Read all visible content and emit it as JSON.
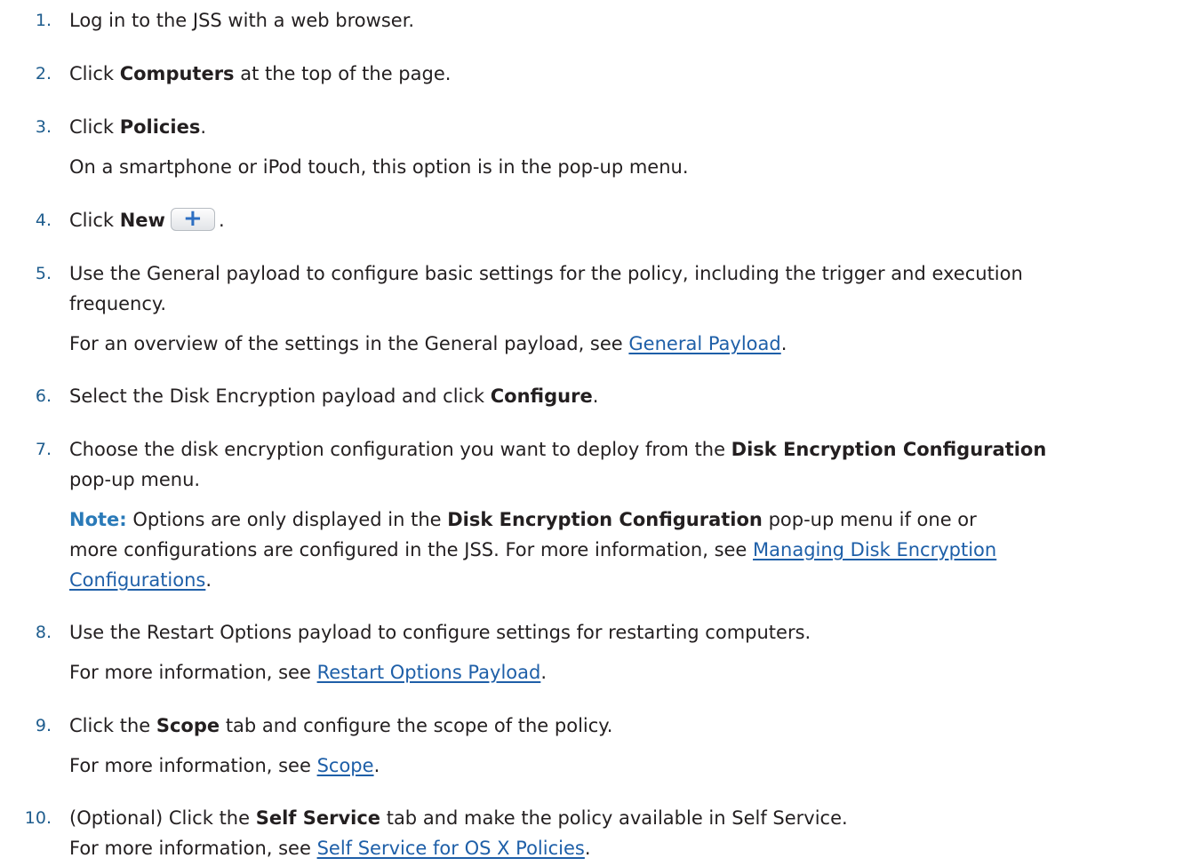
{
  "steps": [
    {
      "num": "1.",
      "lines": [
        {
          "parts": [
            {
              "t": "Log in to the JSS with a web browser."
            }
          ]
        }
      ]
    },
    {
      "num": "2.",
      "lines": [
        {
          "parts": [
            {
              "t": "Click "
            },
            {
              "t": "Computers",
              "b": true
            },
            {
              "t": " at the top of the page."
            }
          ]
        }
      ]
    },
    {
      "num": "3.",
      "lines": [
        {
          "parts": [
            {
              "t": "Click "
            },
            {
              "t": "Policies",
              "b": true
            },
            {
              "t": "."
            }
          ]
        },
        {
          "parts": [
            {
              "t": "On a smartphone or iPod touch, this option is in the pop-up menu."
            }
          ]
        }
      ]
    },
    {
      "num": "4.",
      "lines": [
        {
          "parts": [
            {
              "t": "Click "
            },
            {
              "t": "New",
              "b": true
            },
            {
              "icon": "plus-icon"
            },
            {
              "t": "."
            }
          ]
        }
      ]
    },
    {
      "num": "5.",
      "lines": [
        {
          "parts": [
            {
              "t": "Use the General payload to configure basic settings for the policy, including the trigger and execution"
            }
          ]
        },
        {
          "parts": [
            {
              "t": "frequency."
            }
          ]
        },
        {
          "parts": [
            {
              "t": "For an overview of the settings in the General payload, see "
            },
            {
              "t": "General Payload",
              "link": true
            },
            {
              "t": "."
            }
          ]
        }
      ]
    },
    {
      "num": "6.",
      "lines": [
        {
          "parts": [
            {
              "t": "Select the Disk Encryption payload and click "
            },
            {
              "t": "Configure",
              "b": true
            },
            {
              "t": "."
            }
          ]
        }
      ]
    },
    {
      "num": "7.",
      "lines": [
        {
          "parts": [
            {
              "t": "Choose the disk encryption configuration you want to deploy from the "
            },
            {
              "t": "Disk Encryption Configuration",
              "b": true
            }
          ]
        },
        {
          "parts": [
            {
              "t": "pop-up menu."
            }
          ]
        },
        {
          "parts": [
            {
              "t": "Note:",
              "note": true
            },
            {
              "t": " Options are only displayed in the "
            },
            {
              "t": "Disk Encryption Configuration",
              "b": true
            },
            {
              "t": " pop-up menu if one or"
            }
          ]
        },
        {
          "parts": [
            {
              "t": "more configurations are configured in the JSS. For more information, see "
            },
            {
              "t": "Managing Disk Encryption ",
              "link": true
            }
          ]
        },
        {
          "parts": [
            {
              "t": "Configurations",
              "link": true
            },
            {
              "t": "."
            }
          ]
        }
      ]
    },
    {
      "num": "8.",
      "lines": [
        {
          "parts": [
            {
              "t": "Use the Restart Options payload to configure settings for restarting computers."
            }
          ]
        },
        {
          "parts": [
            {
              "t": "For more information, see "
            },
            {
              "t": "Restart Options Payload",
              "link": true
            },
            {
              "t": "."
            }
          ]
        }
      ]
    },
    {
      "num": "9.",
      "lines": [
        {
          "parts": [
            {
              "t": "Click the "
            },
            {
              "t": "Scope",
              "b": true
            },
            {
              "t": " tab and configure the scope of the policy."
            }
          ]
        },
        {
          "parts": [
            {
              "t": "For more information, see "
            },
            {
              "t": "Scope",
              "link": true
            },
            {
              "t": "."
            }
          ]
        }
      ]
    },
    {
      "num": "10.",
      "lines": [
        {
          "parts": [
            {
              "t": "(Optional) Click the "
            },
            {
              "t": "Self Service",
              "b": true
            },
            {
              "t": " tab and make the policy available in Self Service."
            }
          ]
        },
        {
          "parts": [
            {
              "t": "For more information, see "
            },
            {
              "t": "Self Service for OS X Policies",
              "link": true
            },
            {
              "t": "."
            }
          ]
        }
      ]
    }
  ],
  "new_button": {
    "glyph": "+"
  },
  "colors": {
    "number": "#1f5d8e",
    "link": "#1e5fa8",
    "note": "#2a7ab8",
    "text": "#231f20"
  }
}
